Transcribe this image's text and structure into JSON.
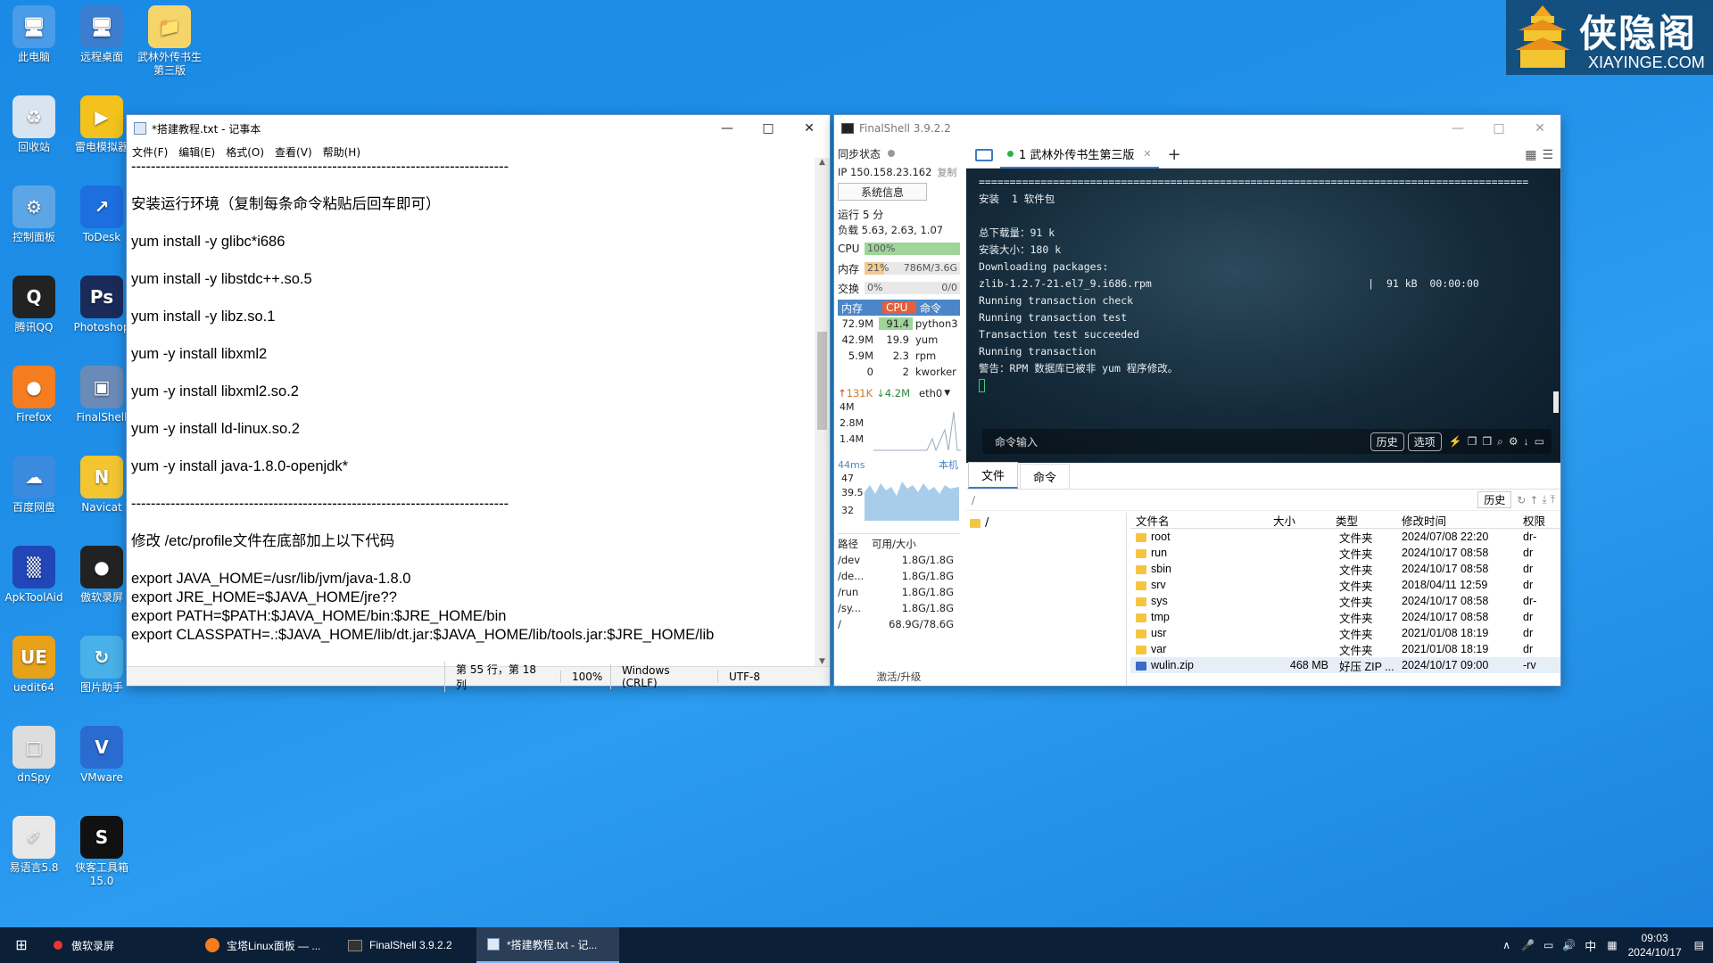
{
  "desktop": {
    "icons": [
      {
        "label": "此电脑",
        "name": "this-pc"
      },
      {
        "label": "远程桌面",
        "name": "remote-desktop"
      },
      {
        "label": "武林外传书生第三版",
        "name": "wulin-folder"
      },
      {
        "label": "回收站",
        "name": "recycle-bin"
      },
      {
        "label": "雷电模拟器",
        "name": "ldplayer"
      },
      {
        "label": "控制面板",
        "name": "control-panel"
      },
      {
        "label": "ToDesk",
        "name": "todesk"
      },
      {
        "label": "腾讯QQ",
        "name": "qq"
      },
      {
        "label": "Photoshop",
        "name": "photoshop"
      },
      {
        "label": "Firefox",
        "name": "firefox"
      },
      {
        "label": "FinalShell",
        "name": "finalshell"
      },
      {
        "label": "百度网盘",
        "name": "baidu-netdisk"
      },
      {
        "label": "Navicat",
        "name": "navicat"
      },
      {
        "label": "ApkToolAid",
        "name": "apktoolaid"
      },
      {
        "label": "傲软录屏",
        "name": "apowersoft-recorder"
      },
      {
        "label": "uedit64",
        "name": "uedit64"
      },
      {
        "label": "图片助手",
        "name": "image-helper"
      },
      {
        "label": "dnSpy",
        "name": "dnspy"
      },
      {
        "label": "VMware",
        "name": "vmware"
      },
      {
        "label": "易语言5.8",
        "name": "eyuyan"
      },
      {
        "label": "侠客工具箱15.0",
        "name": "xiake-toolbox"
      }
    ],
    "watermark_cn": "侠隐阁",
    "watermark_en": "XIAYINGE.COM"
  },
  "notepad": {
    "title": "*搭建教程.txt - 记事本",
    "menu": [
      "文件(F)",
      "编辑(E)",
      "格式(O)",
      "查看(V)",
      "帮助(H)"
    ],
    "lines": [
      "-----------------------------------------------------------------------------",
      "",
      "安装运行环境（复制每条命令粘贴后回车即可）",
      "",
      "yum install -y glibc*i686",
      "",
      "yum install -y libstdc++.so.5",
      "",
      "yum install -y libz.so.1",
      "",
      "yum -y install libxml2",
      "",
      "yum -y install libxml2.so.2",
      "",
      "yum -y install ld-linux.so.2",
      "",
      "yum -y install java-1.8.0-openjdk*",
      "",
      "-----------------------------------------------------------------------------",
      "",
      "修改 /etc/profile文件在底部加上以下代码",
      "",
      "export JAVA_HOME=/usr/lib/jvm/java-1.8.0",
      "export JRE_HOME=$JAVA_HOME/jre??",
      "export PATH=$PATH:$JAVA_HOME/bin:$JRE_HOME/bin",
      "export CLASSPATH=.:$JAVA_HOME/lib/dt.jar:$JAVA_HOME/lib/tools.jar:$JRE_HOME/lib"
    ],
    "status": {
      "position": "第 55 行，第 18 列",
      "zoom": "100%",
      "eol": "Windows (CRLF)",
      "encoding": "UTF-8"
    }
  },
  "finalshell": {
    "title": "FinalShell 3.9.2.2",
    "sync_label": "同步状态",
    "ip": "IP 150.158.23.162",
    "copy": "复制",
    "sysinfo_btn": "系统信息",
    "uptime": "运行 5 分",
    "load": "负载 5.63, 2.63, 1.07",
    "cpu": {
      "label": "CPU",
      "value": "100%",
      "percent": 100
    },
    "mem": {
      "label": "内存",
      "pct": "21%",
      "value": "786M/3.6G",
      "percent": 21
    },
    "swap": {
      "label": "交换",
      "pct": "0%",
      "value": "0/0",
      "percent": 0
    },
    "proc_headers": [
      "内存",
      "CPU",
      "命令"
    ],
    "procs": [
      {
        "mem": "72.9M",
        "cpu": "91.4",
        "cmd": "python3"
      },
      {
        "mem": "42.9M",
        "cpu": "19.9",
        "cmd": "yum"
      },
      {
        "mem": "5.9M",
        "cpu": "2.3",
        "cmd": "rpm"
      },
      {
        "mem": "0",
        "cpu": "2",
        "cmd": "kworker"
      }
    ],
    "net": {
      "up": "131K",
      "down": "4.2M",
      "iface": "eth0",
      "scale": [
        "4M",
        "2.8M",
        "1.4M"
      ]
    },
    "latency": {
      "label": "44ms",
      "host": "本机",
      "scale": [
        "47",
        "39.5",
        "32"
      ]
    },
    "disk_headers": [
      "路径",
      "可用/大小"
    ],
    "disks": [
      {
        "path": "/dev",
        "size": "1.8G/1.8G"
      },
      {
        "path": "/de...",
        "size": "1.8G/1.8G"
      },
      {
        "path": "/run",
        "size": "1.8G/1.8G"
      },
      {
        "path": "/sy...",
        "size": "1.8G/1.8G"
      },
      {
        "path": "/",
        "size": "68.9G/78.6G"
      }
    ],
    "activate": "激活/升级",
    "tab": "1 武林外传书生第三版",
    "terminal": [
      "=========================================================================================",
      "安装  1 软件包",
      "",
      "总下载量：91 k",
      "安装大小：180 k",
      "Downloading packages:",
      "zlib-1.2.7-21.el7_9.i686.rpm                                   |  91 kB  00:00:00",
      "Running transaction check",
      "Running transaction test",
      "Transaction test succeeded",
      "Running transaction",
      "警告：RPM 数据库已被非 yum 程序修改。"
    ],
    "cmd_placeholder": "命令输入",
    "cmd_history": "历史",
    "cmd_options": "选项",
    "bottom_tabs": [
      "文件",
      "命令"
    ],
    "path": "/",
    "history_btn": "历史",
    "tree_root": "/",
    "file_headers": [
      "文件名",
      "大小",
      "类型",
      "修改时间",
      "权限"
    ],
    "files": [
      {
        "name": "root",
        "size": "",
        "type": "文件夹",
        "time": "2024/07/08 22:20",
        "perm": "dr-"
      },
      {
        "name": "run",
        "size": "",
        "type": "文件夹",
        "time": "2024/10/17 08:58",
        "perm": "dr"
      },
      {
        "name": "sbin",
        "size": "",
        "type": "文件夹",
        "time": "2024/10/17 08:58",
        "perm": "dr"
      },
      {
        "name": "srv",
        "size": "",
        "type": "文件夹",
        "time": "2018/04/11 12:59",
        "perm": "dr"
      },
      {
        "name": "sys",
        "size": "",
        "type": "文件夹",
        "time": "2024/10/17 08:58",
        "perm": "dr-"
      },
      {
        "name": "tmp",
        "size": "",
        "type": "文件夹",
        "time": "2024/10/17 08:58",
        "perm": "dr"
      },
      {
        "name": "usr",
        "size": "",
        "type": "文件夹",
        "time": "2021/01/08 18:19",
        "perm": "dr"
      },
      {
        "name": "var",
        "size": "",
        "type": "文件夹",
        "time": "2021/01/08 18:19",
        "perm": "dr"
      },
      {
        "name": "wulin.zip",
        "size": "468 MB",
        "type": "好压 ZIP ...",
        "time": "2024/10/17 09:00",
        "perm": "-rv"
      }
    ]
  },
  "taskbar": {
    "tasks": [
      "傲软录屏",
      "宝塔Linux面板 — ...",
      "FinalShell 3.9.2.2",
      "*搭建教程.txt - 记..."
    ],
    "ime": "中",
    "time": "09:03",
    "date": "2024/10/17"
  }
}
